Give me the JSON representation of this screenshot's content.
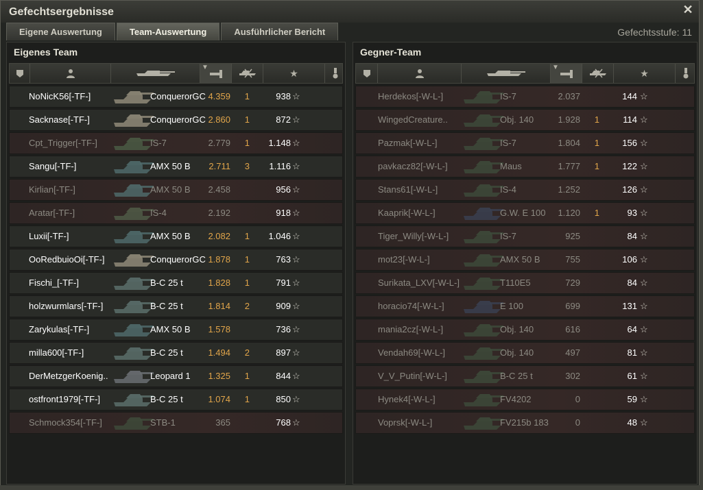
{
  "window": {
    "title": "Gefechtsergebnisse",
    "close_icon": "close-icon"
  },
  "tabs": [
    {
      "label": "Eigene Auswertung",
      "active": false
    },
    {
      "label": "Team-Auswertung",
      "active": true
    },
    {
      "label": "Ausführlicher Bericht",
      "active": false
    }
  ],
  "battle_level": "Gefechtsstufe: 11",
  "columns_icons": [
    "squad-icon",
    "player-icon",
    "tank-icon",
    "damage-icon",
    "kills-icon",
    "xp-star-icon",
    "medal-icon"
  ],
  "own_team": {
    "title": "Eigenes Team",
    "players": [
      {
        "name": "NoNicK56[-TF-]",
        "tank": "ConquerorGC",
        "damage": "4.359",
        "kills": "1",
        "xp": "938",
        "dead": false,
        "tank_color": "#8f8a78"
      },
      {
        "name": "Sacknase[-TF-]",
        "tank": "ConquerorGC",
        "damage": "2.860",
        "kills": "1",
        "xp": "872",
        "dead": false,
        "tank_color": "#8f8a78"
      },
      {
        "name": "Cpt_Trigger[-TF-]",
        "tank": "IS-7",
        "damage": "2.779",
        "kills": "1",
        "xp": "1.148",
        "dead": true,
        "tank_color": "#4a5a44"
      },
      {
        "name": "Sangu[-TF-]",
        "tank": "AMX 50 B",
        "damage": "2.711",
        "kills": "3",
        "xp": "1.116",
        "dead": false,
        "tank_color": "#4f6a6a"
      },
      {
        "name": "Kirlian[-TF-]",
        "tank": "AMX 50 B",
        "damage": "2.458",
        "kills": "",
        "xp": "956",
        "dead": true,
        "tank_color": "#4f6a6a"
      },
      {
        "name": "Aratar[-TF-]",
        "tank": "IS-4",
        "damage": "2.192",
        "kills": "",
        "xp": "918",
        "dead": true,
        "tank_color": "#4f5a46"
      },
      {
        "name": "Luxii[-TF-]",
        "tank": "AMX 50 B",
        "damage": "2.082",
        "kills": "1",
        "xp": "1.046",
        "dead": false,
        "tank_color": "#4f6a6a"
      },
      {
        "name": "OoRedbuioOi[-TF-]",
        "tank": "ConquerorGC",
        "damage": "1.878",
        "kills": "1",
        "xp": "763",
        "dead": false,
        "tank_color": "#8f8a78"
      },
      {
        "name": "Fischi_[-TF-]",
        "tank": "B-C 25 t",
        "damage": "1.828",
        "kills": "1",
        "xp": "791",
        "dead": false,
        "tank_color": "#5a6e6a"
      },
      {
        "name": "holzwurmlars[-TF-]",
        "tank": "B-C 25 t",
        "damage": "1.814",
        "kills": "2",
        "xp": "909",
        "dead": false,
        "tank_color": "#5a6e6a"
      },
      {
        "name": "Zarykulas[-TF-]",
        "tank": "AMX 50 B",
        "damage": "1.578",
        "kills": "",
        "xp": "736",
        "dead": false,
        "tank_color": "#4f6a6a"
      },
      {
        "name": "milla600[-TF-]",
        "tank": "B-C 25 t",
        "damage": "1.494",
        "kills": "2",
        "xp": "897",
        "dead": false,
        "tank_color": "#5a6e6a"
      },
      {
        "name": "DerMetzgerKoenig..",
        "tank": "Leopard 1",
        "damage": "1.325",
        "kills": "1",
        "xp": "844",
        "dead": false,
        "tank_color": "#6a6e72"
      },
      {
        "name": "ostfront1979[-TF-]",
        "tank": "B-C 25 t",
        "damage": "1.074",
        "kills": "1",
        "xp": "850",
        "dead": false,
        "tank_color": "#5a6e6a"
      },
      {
        "name": "Schmock354[-TF-]",
        "tank": "STB-1",
        "damage": "365",
        "kills": "",
        "xp": "768",
        "dead": true,
        "tank_color": "#3e4a3a"
      }
    ]
  },
  "enemy_team": {
    "title": "Gegner-Team",
    "players": [
      {
        "name": "Herdekos[-W-L-]",
        "tank": "IS-7",
        "damage": "2.037",
        "kills": "",
        "xp": "144",
        "dead": true,
        "tank_color": "#3d4a3a"
      },
      {
        "name": "WingedCreature..",
        "tank": "Obj. 140",
        "damage": "1.928",
        "kills": "1",
        "xp": "114",
        "dead": true,
        "tank_color": "#3d4a3a"
      },
      {
        "name": "Pazmak[-W-L-]",
        "tank": "IS-7",
        "damage": "1.804",
        "kills": "1",
        "xp": "156",
        "dead": true,
        "tank_color": "#3d4a3a"
      },
      {
        "name": "pavkacz82[-W-L-]",
        "tank": "Maus",
        "damage": "1.777",
        "kills": "1",
        "xp": "122",
        "dead": true,
        "tank_color": "#3d4a3a"
      },
      {
        "name": "Stans61[-W-L-]",
        "tank": "IS-4",
        "damage": "1.252",
        "kills": "",
        "xp": "126",
        "dead": true,
        "tank_color": "#3d4a3a"
      },
      {
        "name": "Kaaprik[-W-L-]",
        "tank": "G.W. E 100",
        "damage": "1.120",
        "kills": "1",
        "xp": "93",
        "dead": true,
        "tank_color": "#3a4050"
      },
      {
        "name": "Tiger_Willy[-W-L-]",
        "tank": "IS-7",
        "damage": "925",
        "kills": "",
        "xp": "84",
        "dead": true,
        "tank_color": "#3d4a3a"
      },
      {
        "name": "mot23[-W-L-]",
        "tank": "AMX 50 B",
        "damage": "755",
        "kills": "",
        "xp": "106",
        "dead": true,
        "tank_color": "#3d4a3a"
      },
      {
        "name": "Surikata_LXV[-W-L-]",
        "tank": "T110E5",
        "damage": "729",
        "kills": "",
        "xp": "84",
        "dead": true,
        "tank_color": "#3d4a3a"
      },
      {
        "name": "horacio74[-W-L-]",
        "tank": "E 100",
        "damage": "699",
        "kills": "",
        "xp": "131",
        "dead": true,
        "tank_color": "#3a4050"
      },
      {
        "name": "mania2cz[-W-L-]",
        "tank": "Obj. 140",
        "damage": "616",
        "kills": "",
        "xp": "64",
        "dead": true,
        "tank_color": "#3d4a3a"
      },
      {
        "name": "Vendah69[-W-L-]",
        "tank": "Obj. 140",
        "damage": "497",
        "kills": "",
        "xp": "81",
        "dead": true,
        "tank_color": "#3d4a3a"
      },
      {
        "name": "V_V_Putin[-W-L-]",
        "tank": "B-C 25 t",
        "damage": "302",
        "kills": "",
        "xp": "61",
        "dead": true,
        "tank_color": "#3d4a3a"
      },
      {
        "name": "Hynek4[-W-L-]",
        "tank": "FV4202",
        "damage": "0",
        "kills": "",
        "xp": "59",
        "dead": true,
        "tank_color": "#3d4a3a"
      },
      {
        "name": "Voprsk[-W-L-]",
        "tank": "FV215b 183",
        "damage": "0",
        "kills": "",
        "xp": "48",
        "dead": true,
        "tank_color": "#3d4a3a"
      }
    ]
  },
  "colors": {
    "damage_gold": "#e1a54a",
    "alive_name": "#ffffff",
    "dead_name": "#8c8a82"
  }
}
